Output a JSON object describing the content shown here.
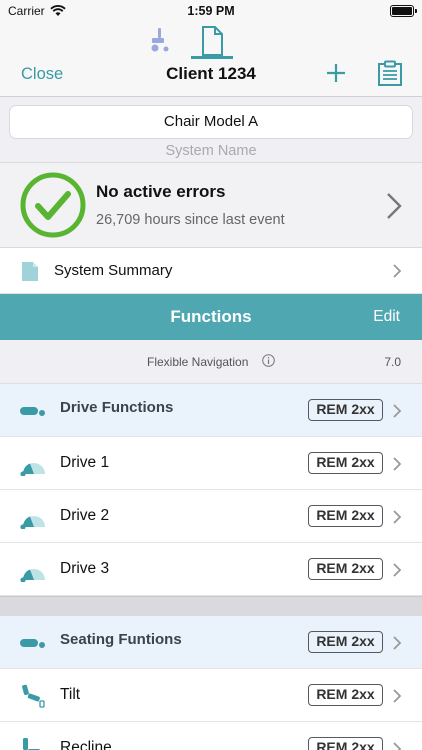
{
  "status_bar": {
    "carrier": "Carrier",
    "time": "1:59 PM"
  },
  "nav": {
    "close_label": "Close",
    "title": "Client 1234"
  },
  "system": {
    "name_value": "Chair Model A",
    "caption": "System Name"
  },
  "errors": {
    "title": "No active errors",
    "subtitle": "26,709 hours since last event"
  },
  "summary": {
    "label": "System Summary"
  },
  "functions": {
    "title": "Functions",
    "edit_label": "Edit",
    "flex_label": "Flexible Navigation",
    "flex_version": "7.0"
  },
  "rows": [
    {
      "label": "Drive Functions",
      "badge": "REM 2xx"
    },
    {
      "label": "Drive 1",
      "badge": "REM 2xx"
    },
    {
      "label": "Drive 2",
      "badge": "REM 2xx"
    },
    {
      "label": "Drive 3",
      "badge": "REM 2xx"
    },
    {
      "label": "Seating Funtions",
      "badge": "REM 2xx"
    },
    {
      "label": "Tilt",
      "badge": "REM 2xx"
    },
    {
      "label": "Recline",
      "badge": "REM 2xx"
    }
  ],
  "colors": {
    "accent": "#3a9aa6",
    "header_bg": "#4fa7b1",
    "check_green": "#58b431",
    "group_bg": "#eaf3fb"
  }
}
